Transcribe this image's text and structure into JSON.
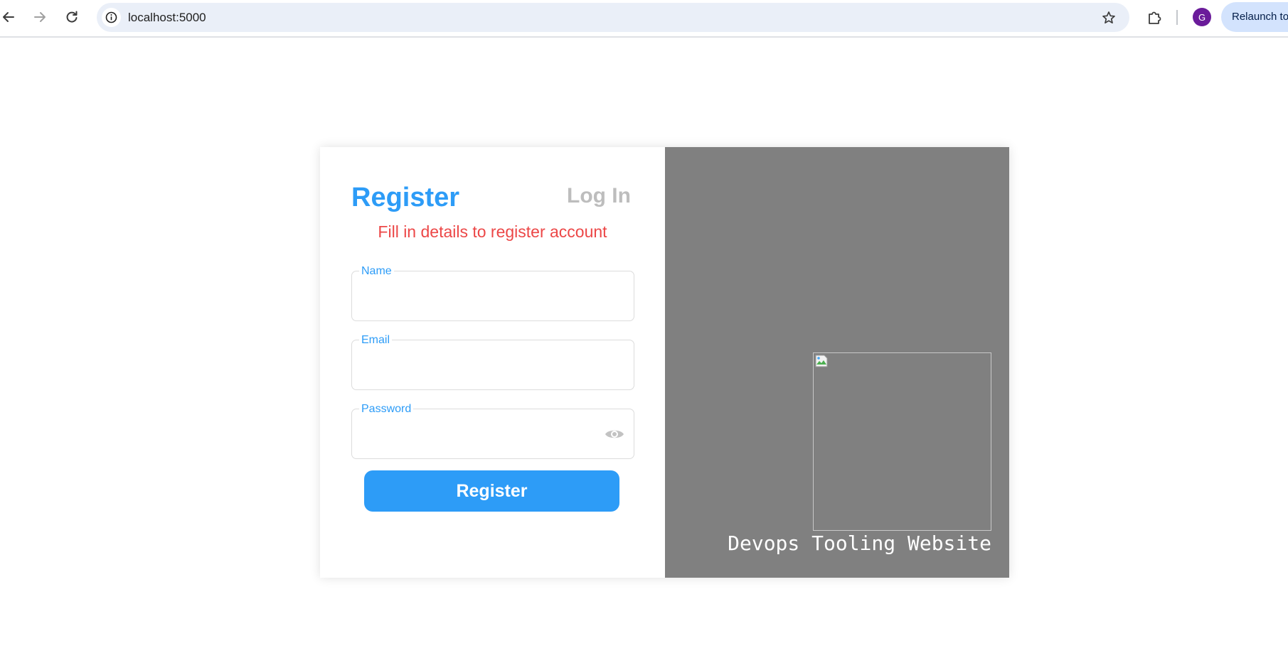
{
  "browser": {
    "url": "localhost:5000",
    "profile_initial": "G",
    "relaunch_label": "Relaunch to"
  },
  "form": {
    "tab_register": "Register",
    "tab_login": "Log In",
    "subtitle": "Fill in details to register account",
    "name_label": "Name",
    "name_value": "",
    "email_label": "Email",
    "email_value": "",
    "password_label": "Password",
    "password_value": "",
    "submit_label": "Register"
  },
  "side_panel": {
    "caption": "Devops Tooling Website"
  },
  "colors": {
    "accent": "#2d9cf7",
    "subtitle": "#ec4747",
    "inactive_tab": "#bdbdbd",
    "panel_bg": "#808080"
  },
  "icons": {
    "back": "arrow-left-icon",
    "forward": "arrow-right-icon",
    "reload": "reload-icon",
    "site_info": "info-icon",
    "bookmark": "star-icon",
    "extensions": "puzzle-icon",
    "password_toggle": "eye-icon",
    "broken_image": "broken-image-icon"
  }
}
